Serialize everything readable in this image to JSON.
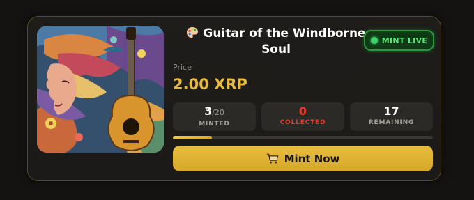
{
  "nft": {
    "title": "Guitar of the Windborne Soul",
    "title_icon": "artist-palette-icon"
  },
  "status_badge": {
    "label": "MINT LIVE",
    "dot_color": "#3fd16a"
  },
  "price": {
    "label": "Price",
    "value": "2.00 XRP"
  },
  "stats": {
    "minted": {
      "value": "3",
      "total": "/20",
      "label": "MINTED"
    },
    "collected": {
      "value": "0",
      "label": "COLLECTED"
    },
    "remaining": {
      "value": "17",
      "label": "REMAINING"
    }
  },
  "progress": {
    "fraction": 0.15
  },
  "mint_button": {
    "label": "Mint Now",
    "icon": "cart-icon"
  },
  "colors": {
    "accent": "#e8b93a",
    "live": "#3fd16a",
    "collected": "#e5392b"
  }
}
